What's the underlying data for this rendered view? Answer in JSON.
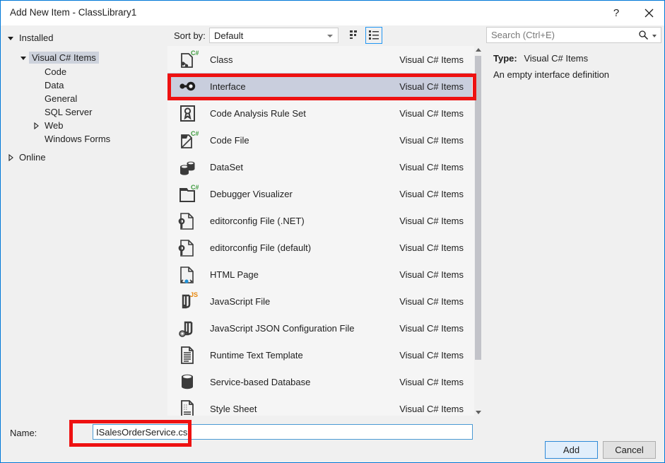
{
  "window": {
    "title": "Add New Item - ClassLibrary1",
    "help_glyph": "?",
    "close_glyph": "close-icon"
  },
  "sidebar": {
    "groups": [
      {
        "label": "Installed",
        "expander": "expanded",
        "indent": 0,
        "selected": false
      },
      {
        "label": "Visual C# Items",
        "expander": "expanded",
        "indent": 1,
        "selected": true
      },
      {
        "label": "Code",
        "expander": "none",
        "indent": 2,
        "selected": false
      },
      {
        "label": "Data",
        "expander": "none",
        "indent": 2,
        "selected": false
      },
      {
        "label": "General",
        "expander": "none",
        "indent": 2,
        "selected": false
      },
      {
        "label": "SQL Server",
        "expander": "none",
        "indent": 2,
        "selected": false
      },
      {
        "label": "Web",
        "expander": "collapsed",
        "indent": 2,
        "selected": false
      },
      {
        "label": "Windows Forms",
        "expander": "none",
        "indent": 2,
        "selected": false
      },
      {
        "label": "Online",
        "expander": "collapsed",
        "indent": 0,
        "selected": false
      }
    ]
  },
  "toolbar": {
    "sort_label": "Sort by:",
    "sort_value": "Default",
    "view_tiles_icon": "tiles-view-icon",
    "view_list_icon": "list-view-icon",
    "view_selected": "list"
  },
  "search": {
    "placeholder": "Search (Ctrl+E)",
    "icon": "search-icon"
  },
  "items": [
    {
      "name": "Class",
      "category": "Visual C# Items",
      "icon": "class-csharp-icon",
      "selected": false
    },
    {
      "name": "Interface",
      "category": "Visual C# Items",
      "icon": "interface-icon",
      "selected": true
    },
    {
      "name": "Code Analysis Rule Set",
      "category": "Visual C# Items",
      "icon": "rule-set-icon",
      "selected": false
    },
    {
      "name": "Code File",
      "category": "Visual C# Items",
      "icon": "code-file-csharp-icon",
      "selected": false
    },
    {
      "name": "DataSet",
      "category": "Visual C# Items",
      "icon": "dataset-icon",
      "selected": false
    },
    {
      "name": "Debugger Visualizer",
      "category": "Visual C# Items",
      "icon": "debugger-visualizer-icon",
      "selected": false
    },
    {
      "name": "editorconfig File (.NET)",
      "category": "Visual C# Items",
      "icon": "editorconfig-icon",
      "selected": false
    },
    {
      "name": "editorconfig File (default)",
      "category": "Visual C# Items",
      "icon": "editorconfig-icon",
      "selected": false
    },
    {
      "name": "HTML Page",
      "category": "Visual C# Items",
      "icon": "html-page-icon",
      "selected": false
    },
    {
      "name": "JavaScript File",
      "category": "Visual C# Items",
      "icon": "javascript-file-icon",
      "selected": false
    },
    {
      "name": "JavaScript JSON Configuration File",
      "category": "Visual C# Items",
      "icon": "json-config-icon",
      "selected": false
    },
    {
      "name": "Runtime Text Template",
      "category": "Visual C# Items",
      "icon": "text-template-icon",
      "selected": false
    },
    {
      "name": "Service-based Database",
      "category": "Visual C# Items",
      "icon": "database-icon",
      "selected": false
    },
    {
      "name": "Style Sheet",
      "category": "Visual C# Items",
      "icon": "style-sheet-icon",
      "selected": false
    }
  ],
  "details": {
    "type_label": "Type:",
    "type_value": "Visual C# Items",
    "description": "An empty interface definition"
  },
  "footer": {
    "name_label": "Name:",
    "name_value": "ISalesOrderService.cs",
    "add_label": "Add",
    "cancel_label": "Cancel"
  },
  "colors": {
    "accent": "#0078d7",
    "selection": "#c9cedd",
    "annotation": "#ee1111",
    "csharp_green": "#3c9a3c"
  }
}
